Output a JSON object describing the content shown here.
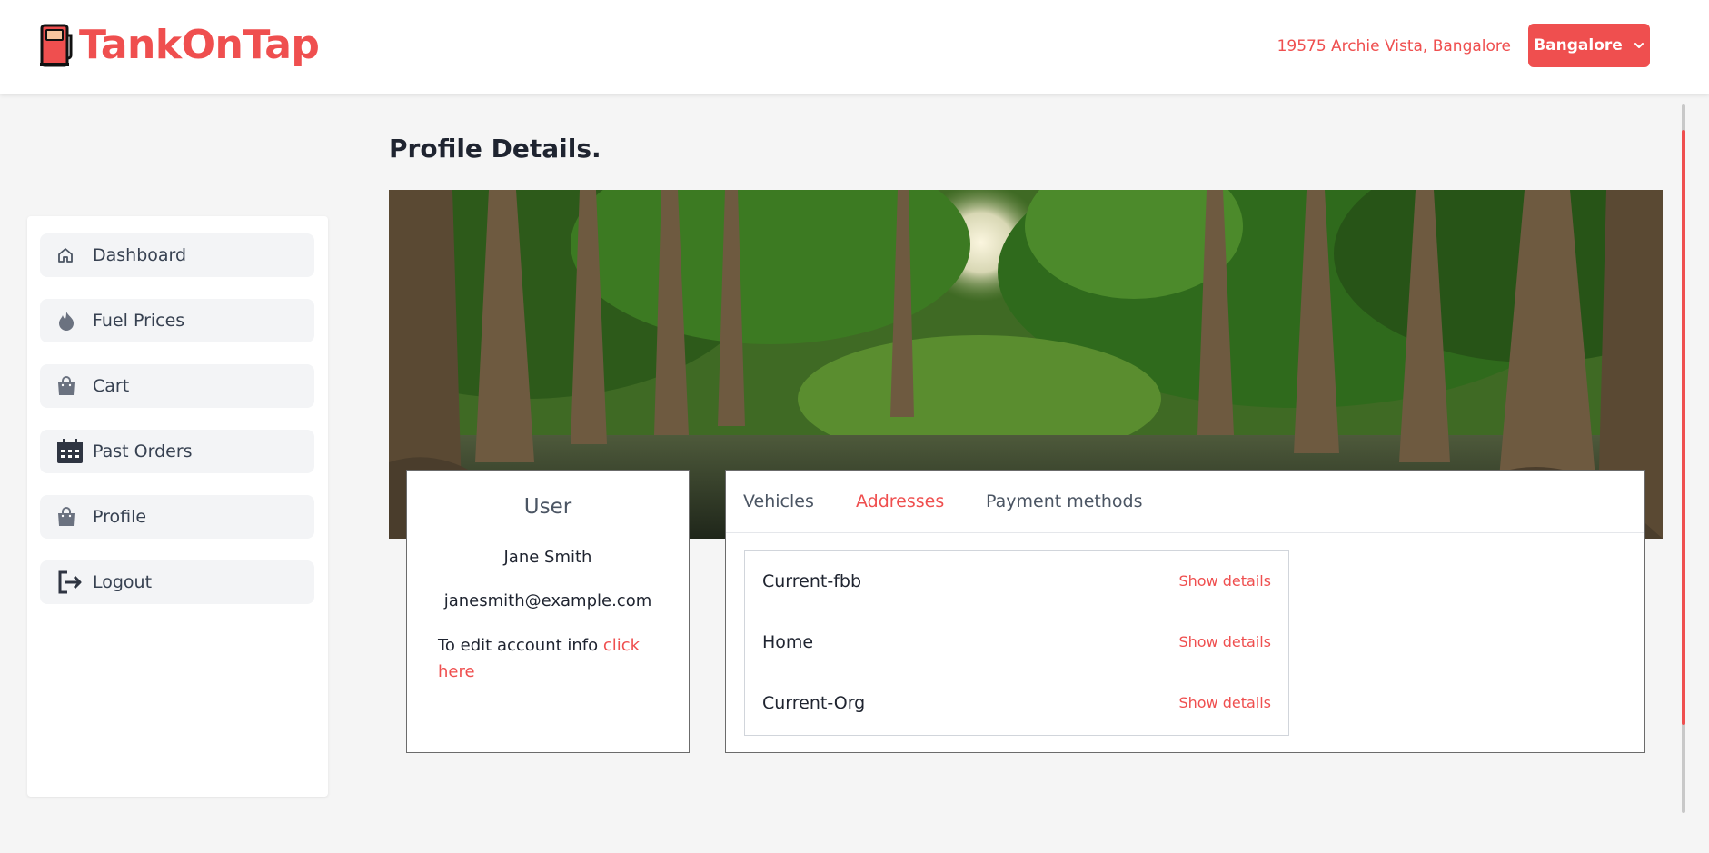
{
  "brand": {
    "name": "TankOnTap",
    "icon": "fuel-pump-icon",
    "color": "#ef4f4f"
  },
  "header": {
    "address": "19575 Archie Vista, Bangalore",
    "city": "Bangalore",
    "city_icon": "chevron-down-icon"
  },
  "sidebar": {
    "items": [
      {
        "label": "Dashboard",
        "icon": "home-icon"
      },
      {
        "label": "Fuel Prices",
        "icon": "flame-icon"
      },
      {
        "label": "Cart",
        "icon": "shopping-bag-icon"
      },
      {
        "label": "Past Orders",
        "icon": "calendar-icon"
      },
      {
        "label": "Profile",
        "icon": "shopping-bag-icon"
      },
      {
        "label": "Logout",
        "icon": "logout-icon"
      }
    ]
  },
  "main": {
    "title": "Profile Details.",
    "banner": "forest-river-image",
    "user": {
      "heading": "User",
      "name": "Jane Smith",
      "email": "janesmith@example.com",
      "edit_text": "To edit account info ",
      "edit_link": "click here"
    },
    "tabs": [
      {
        "label": "Vehicles",
        "active": false
      },
      {
        "label": "Addresses",
        "active": true
      },
      {
        "label": "Payment methods",
        "active": false
      }
    ],
    "addresses": [
      {
        "name": "Current-fbb",
        "action": "Show details"
      },
      {
        "name": "Home",
        "action": "Show details"
      },
      {
        "name": "Current-Org",
        "action": "Show details"
      }
    ]
  },
  "colors": {
    "accent": "#ef4f4f",
    "page_bg": "#f5f5f5",
    "nav_bg": "#f3f4f6"
  }
}
